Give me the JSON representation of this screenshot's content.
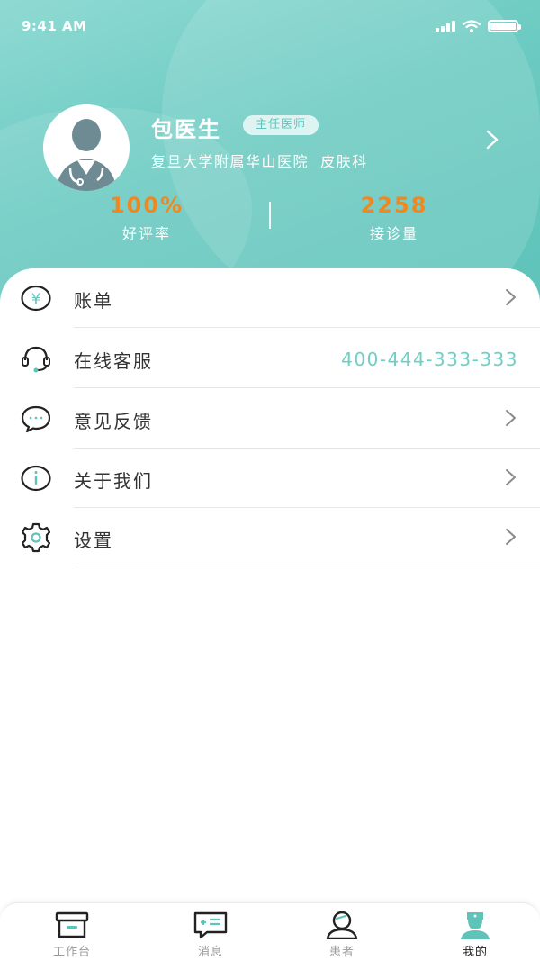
{
  "status_bar": {
    "time": "9:41 AM"
  },
  "profile": {
    "name": "包医生",
    "title_badge": "主任医师",
    "hospital_department": "复旦大学附属华山医院  皮肤科"
  },
  "stats": [
    {
      "value": "100%",
      "label": "好评率"
    },
    {
      "value": "2258",
      "label": "接诊量"
    }
  ],
  "menu": [
    {
      "label": "账单",
      "icon": "yen-icon"
    },
    {
      "label": "在线客服",
      "icon": "headset-icon",
      "value": "400-444-333-333"
    },
    {
      "label": "意见反馈",
      "icon": "chat-bubble-icon"
    },
    {
      "label": "关于我们",
      "icon": "info-icon"
    },
    {
      "label": "设置",
      "icon": "gear-icon"
    }
  ],
  "tabbar": [
    {
      "label": "工作台",
      "icon": "inbox-icon"
    },
    {
      "label": "消息",
      "icon": "message-icon"
    },
    {
      "label": "患者",
      "icon": "patient-icon"
    },
    {
      "label": "我的",
      "icon": "nurse-icon"
    }
  ],
  "colors": {
    "accent": "#5fc3ba",
    "stat_number": "#f0871f",
    "phone": "#6fcfc6",
    "tab_active": "#222222",
    "tab_inactive": "#9b9b9b"
  }
}
